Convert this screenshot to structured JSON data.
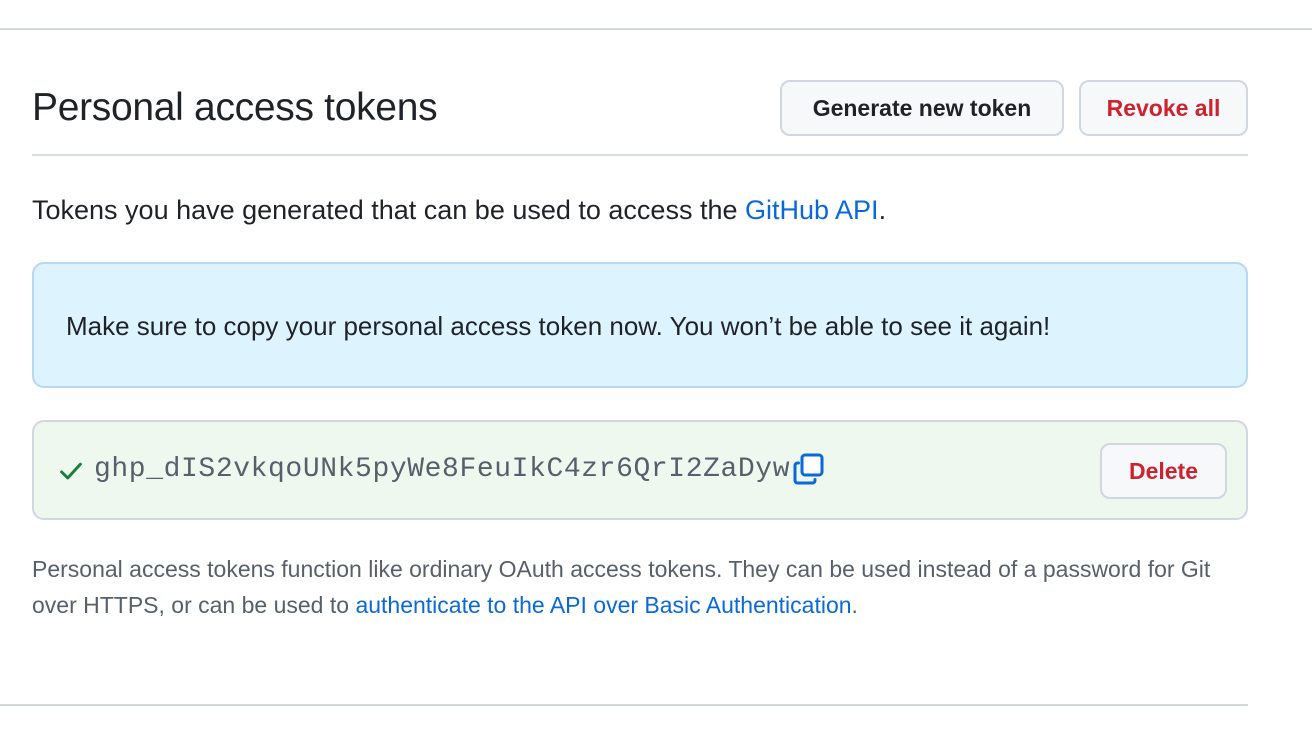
{
  "page": {
    "title": "Personal access tokens"
  },
  "header": {
    "generate_label": "Generate new token",
    "revoke_label": "Revoke all"
  },
  "intro": {
    "text": "Tokens you have generated that can be used to access the ",
    "link_label": "GitHub API",
    "suffix": "."
  },
  "flash": {
    "message": "Make sure to copy your personal access token now. You won’t be able to see it again!"
  },
  "token": {
    "value": "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",
    "status_icon": "check-icon",
    "copy_icon": "copy-icon",
    "delete_label": "Delete"
  },
  "note": {
    "text": "Personal access tokens function like ordinary OAuth access tokens. They can be used instead of a password for Git over HTTPS, or can be used to ",
    "link_label": "authenticate to the API over Basic Authentication",
    "suffix": "."
  },
  "colors": {
    "accent": "#0969da",
    "danger": "#cf222e",
    "success": "#1a7f37",
    "info_bg": "#ddf4ff",
    "success_bg": "#eff8ef"
  }
}
